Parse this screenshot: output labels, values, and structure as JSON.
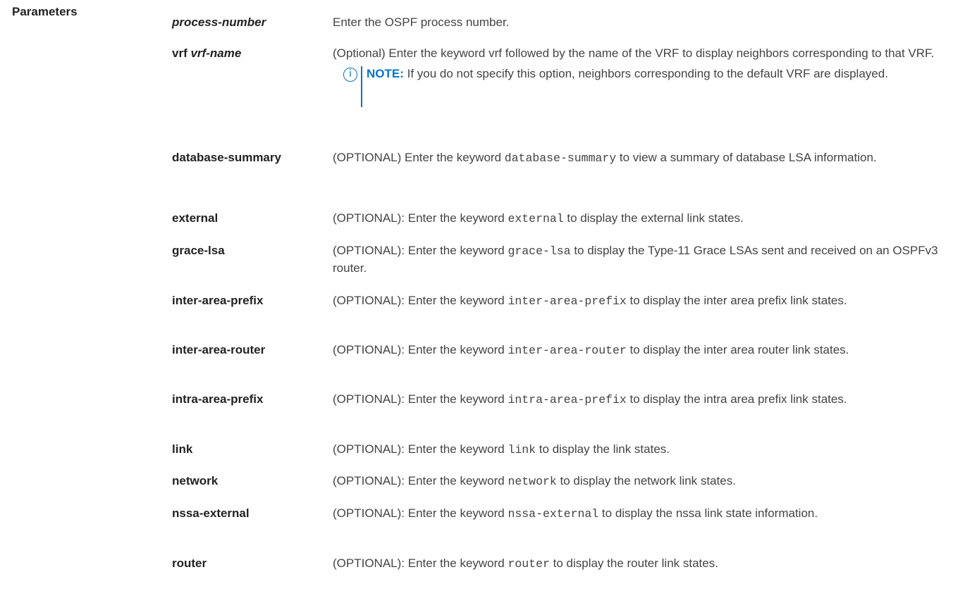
{
  "section": {
    "label": "Parameters"
  },
  "params": [
    {
      "term_a": "process-number",
      "term_b": "",
      "desc_a": "Enter the OSPF process number.",
      "code": "",
      "desc_b": ""
    },
    {
      "term_a": "vrf",
      "term_b": "vrf-name",
      "desc_a": "(Optional) Enter the keyword vrf followed by the name of the VRF to display neighbors corresponding to that VRF.",
      "code": "",
      "desc_b": ""
    },
    {
      "term_a": "database-summary",
      "term_b": "",
      "desc_a": "(OPTIONAL) Enter the keyword ",
      "code": "database-summary",
      "desc_b": " to view a summary of database LSA information."
    },
    {
      "term_a": "external",
      "term_b": "",
      "desc_a": "(OPTIONAL): Enter the keyword ",
      "code": "external",
      "desc_b": " to display the external link states."
    },
    {
      "term_a": "grace-lsa",
      "term_b": "",
      "desc_a": "(OPTIONAL): Enter the keyword ",
      "code": "grace-lsa",
      "desc_b": " to display the Type-11 Grace LSAs sent and received on an OSPFv3 router."
    },
    {
      "term_a": "inter-area-prefix",
      "term_b": "",
      "desc_a": "(OPTIONAL): Enter the keyword ",
      "code": "inter-area-prefix",
      "desc_b": " to display the inter area prefix link states."
    },
    {
      "term_a": "inter-area-router",
      "term_b": "",
      "desc_a": "(OPTIONAL): Enter the keyword ",
      "code": "inter-area-router",
      "desc_b": " to display the inter area router link states."
    },
    {
      "term_a": "intra-area-prefix",
      "term_b": "",
      "desc_a": "(OPTIONAL): Enter the keyword ",
      "code": "intra-area-prefix",
      "desc_b": " to display the intra area prefix link states."
    },
    {
      "term_a": "link",
      "term_b": "",
      "desc_a": "(OPTIONAL): Enter the keyword ",
      "code": "link",
      "desc_b": " to display the link states."
    },
    {
      "term_a": "network",
      "term_b": "",
      "desc_a": "(OPTIONAL): Enter the keyword ",
      "code": "network",
      "desc_b": " to display the network link states."
    },
    {
      "term_a": "nssa-external",
      "term_b": "",
      "desc_a": "(OPTIONAL): Enter the keyword ",
      "code": "nssa-external",
      "desc_b": " to display the nssa link state information."
    },
    {
      "term_a": "router",
      "term_b": "",
      "desc_a": "(OPTIONAL): Enter the keyword ",
      "code": "router",
      "desc_b": " to display the router link states."
    }
  ],
  "note": {
    "icon": "info-circle-icon",
    "icon_glyph": "i",
    "label": "NOTE:",
    "text": " If you do not specify this option, neighbors corresponding to the default VRF are displayed."
  }
}
